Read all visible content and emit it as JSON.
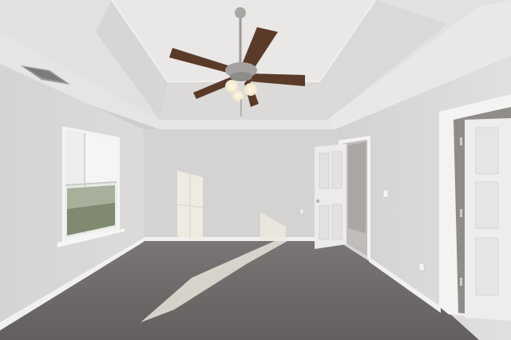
{
  "scene": {
    "description_label": "",
    "palette": {
      "wall_left": "#d9d7d5",
      "wall_back": "#d3d1cf",
      "wall_right": "#dcdad8",
      "ceiling": "#e4e3e1",
      "ceiling_shadow": "#d2d0ce",
      "carpet": "#6e6a69",
      "carpet_light": "#7b7776",
      "trim": "#f4f4f2",
      "door": "#ecebea",
      "fan_blade": "#5a3b2a",
      "fan_metal": "#9c9a97",
      "sunlight": "#f3efe6",
      "window_glass": "#e8ece8"
    }
  }
}
